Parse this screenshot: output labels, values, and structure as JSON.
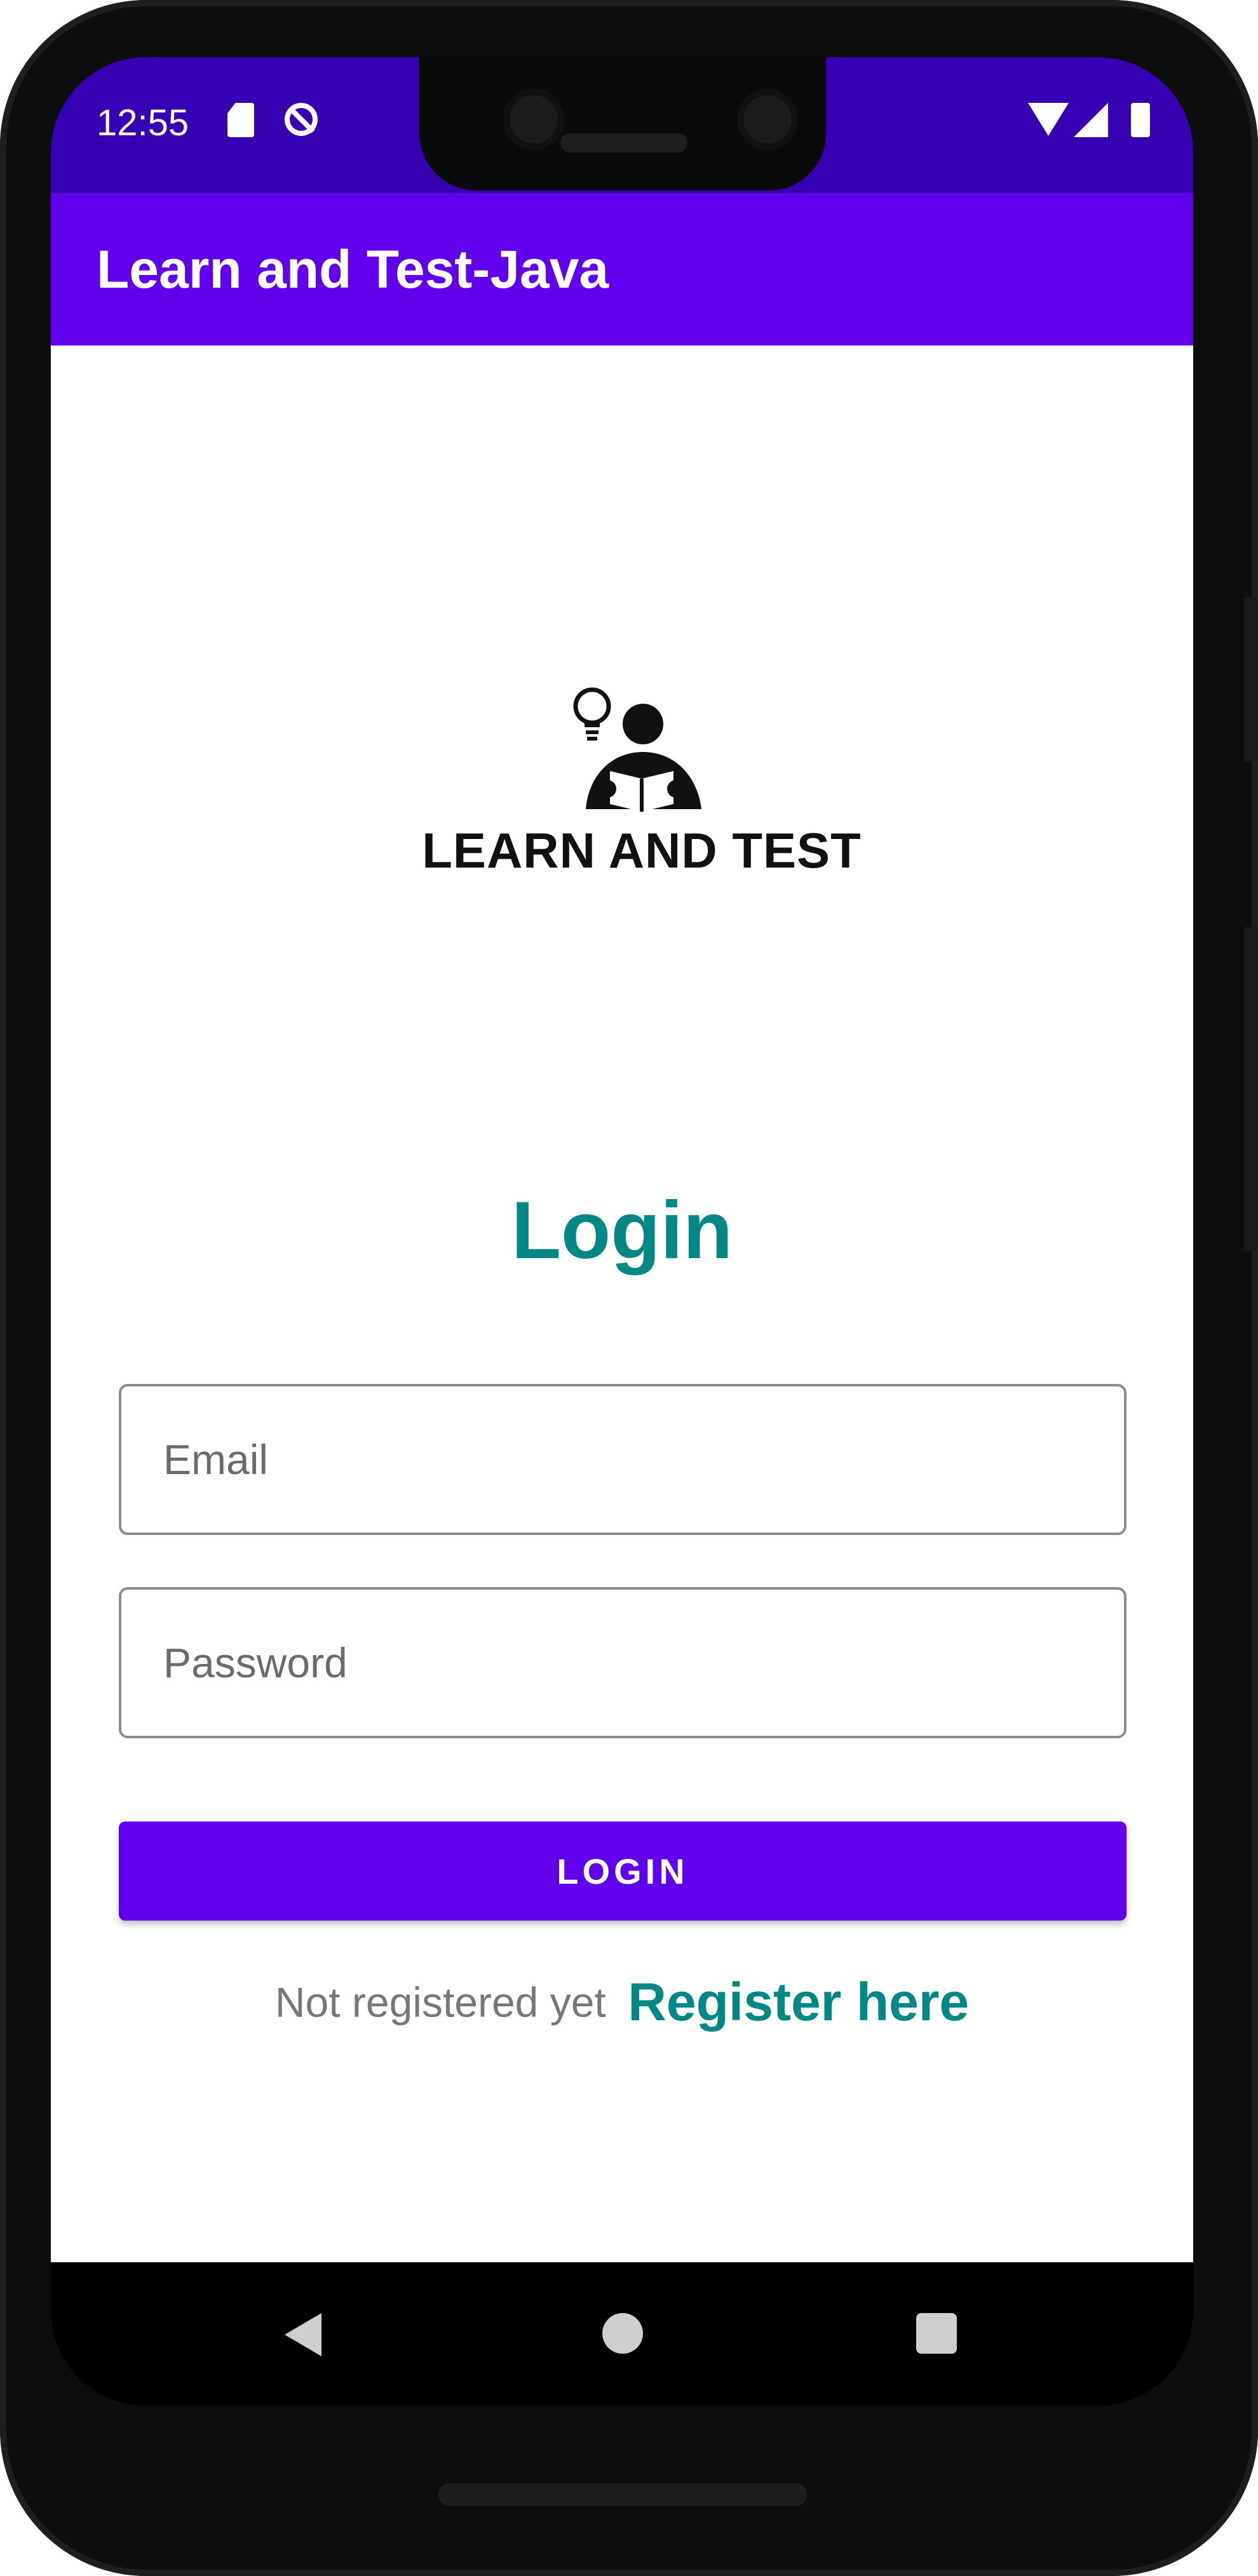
{
  "status_bar": {
    "time": "12:55",
    "icons": [
      "sd-card-icon",
      "sync-disabled-icon",
      "wifi-icon",
      "signal-icon",
      "battery-icon"
    ]
  },
  "app_bar": {
    "title": "Learn and Test-Java"
  },
  "logo": {
    "text": "LEARN AND TEST",
    "icon": "reader-with-lightbulb-icon"
  },
  "login": {
    "title": "Login",
    "email_placeholder": "Email",
    "password_placeholder": "Password",
    "button_label": "LOGIN"
  },
  "register": {
    "prompt": "Not registered yet",
    "link": "Register here"
  },
  "nav_bar": {
    "icons": [
      "back-icon",
      "home-icon",
      "recents-icon"
    ]
  },
  "colors": {
    "status_bar": "#3700B3",
    "primary": "#6200EE",
    "accent_teal": "#018786"
  }
}
